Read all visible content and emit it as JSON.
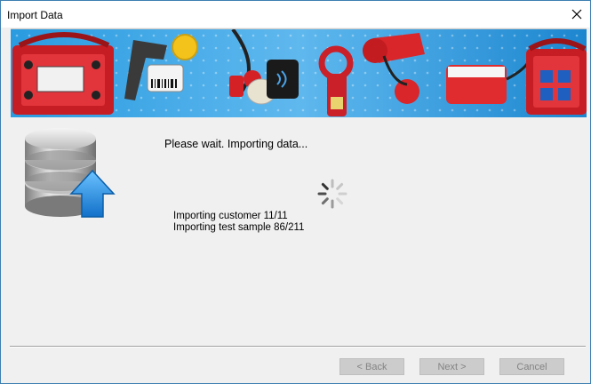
{
  "window": {
    "title": "Import Data"
  },
  "content": {
    "message": "Please wait. Importing data...",
    "status_lines": [
      "Importing customer 11/11",
      "Importing test sample 86/211"
    ]
  },
  "buttons": {
    "back": "< Back",
    "next": "Next >",
    "cancel": "Cancel"
  },
  "icons": {
    "close": "close-icon",
    "database_upload": "database-upload-icon",
    "spinner": "loading-spinner-icon"
  },
  "colors": {
    "window_border": "#3c7fb1",
    "dialog_bg": "#f0f0f0",
    "banner_bg": "#1e8fd6",
    "accent_red": "#d4202a",
    "upload_arrow": "#1f8ee0",
    "disabled_button": "#cccccc"
  }
}
